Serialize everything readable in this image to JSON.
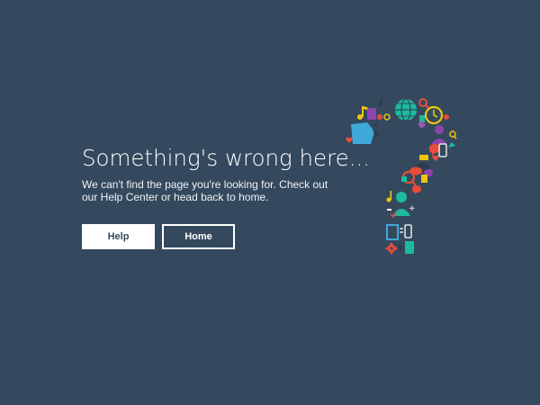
{
  "error": {
    "title": "Something's wrong here...",
    "message": "We can't find the page you're looking for. Check out our Help Center or head back to home."
  },
  "buttons": {
    "help_label": "Help",
    "home_label": "Home"
  },
  "illustration": {
    "name": "question-mark-icon-collage",
    "icons": [
      "music-note-icon",
      "speech-bubble-icon",
      "globe-icon",
      "clock-icon",
      "search-icon",
      "heart-icon",
      "folder-icon",
      "user-icon",
      "phone-icon",
      "tablet-icon",
      "gear-icon",
      "mail-icon",
      "key-icon",
      "document-icon"
    ]
  },
  "colors": {
    "background": "#34495e",
    "text": "#ffffff",
    "accent_teal": "#1abc9c",
    "accent_red": "#e74c3c",
    "accent_blue": "#3fa9d9",
    "accent_purple": "#8e44ad",
    "accent_yellow": "#f1c40f"
  }
}
